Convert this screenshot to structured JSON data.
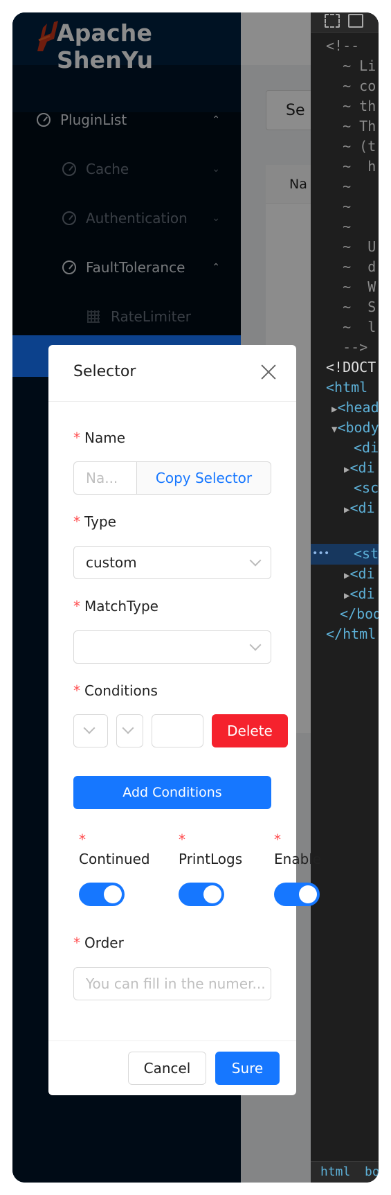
{
  "app": {
    "logo_text": "Apache ShenYu"
  },
  "sidebar": {
    "items": [
      {
        "label": "PluginList",
        "icon": "dashboard-icon",
        "chevron": "up"
      },
      {
        "label": "Cache",
        "icon": "dashboard-icon",
        "chevron": "down"
      },
      {
        "label": "Authentication",
        "icon": "dashboard-icon",
        "chevron": "down"
      },
      {
        "label": "FaultTolerance",
        "icon": "dashboard-icon",
        "chevron": "up"
      },
      {
        "label": "RateLimiter",
        "icon": "table-icon"
      }
    ]
  },
  "page": {
    "search_label": "Se",
    "table_header": "Na"
  },
  "devtools": {
    "lines": [
      "<!--",
      "  ~ Li",
      "  ~ co",
      "  ~ th",
      "  ~ Th",
      "  ~ (t",
      "  ~  h",
      "  ~",
      "  ~",
      "  ~",
      "  ~  U",
      "  ~  d",
      "  ~  W",
      "  ~  S",
      "  ~  l",
      "  -->"
    ],
    "doctype": "<!DOCT",
    "html_open": "<html",
    "head": "<head",
    "body": "<body",
    "div1": "<di",
    "div2": "<di",
    "script": "<sc",
    "div3": "<di",
    "style": "<st",
    "div4": "<di",
    "div5": "<di",
    "body_close": "</bod",
    "html_close": "</html",
    "dots": "•••",
    "breadcrumb_html": "html",
    "breadcrumb_body": "bo"
  },
  "modal": {
    "title": "Selector",
    "name": {
      "label": "Name",
      "placeholder": "Na...",
      "copy_button": "Copy Selector"
    },
    "type": {
      "label": "Type",
      "value": "custom"
    },
    "match_type": {
      "label": "MatchType",
      "value": ""
    },
    "conditions": {
      "label": "Conditions",
      "delete_button": "Delete",
      "add_button": "Add Conditions"
    },
    "switches": [
      {
        "label": "Continued",
        "on": true
      },
      {
        "label": "PrintLogs",
        "on": true
      },
      {
        "label": "Enable",
        "on": true
      }
    ],
    "order": {
      "label": "Order",
      "placeholder": "You can fill in the numer..."
    },
    "cancel_button": "Cancel",
    "sure_button": "Sure",
    "required_mark": "*"
  },
  "colors": {
    "primary": "#1677ff",
    "danger": "#f5222d",
    "sidebar": "#001529"
  }
}
